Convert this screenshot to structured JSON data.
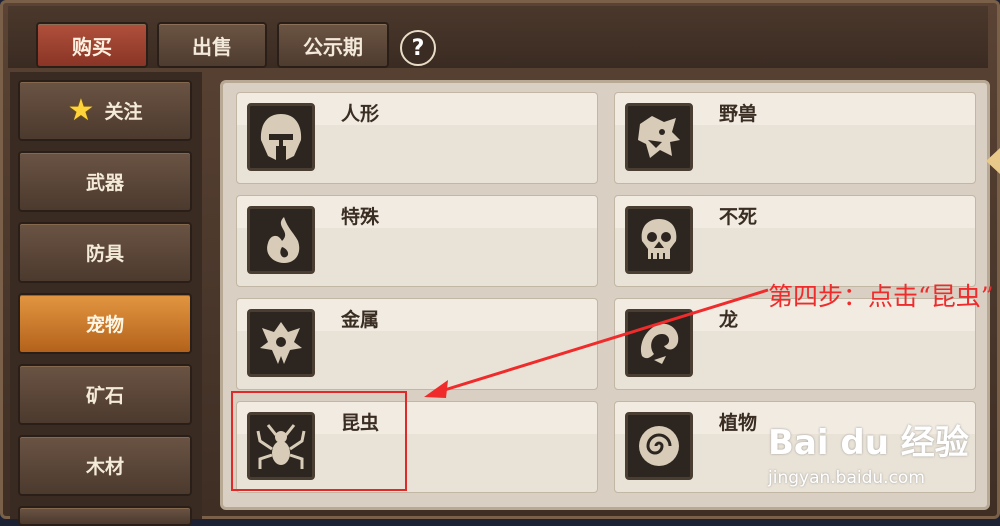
{
  "tabs": [
    {
      "label": "购买",
      "active": true
    },
    {
      "label": "出售",
      "active": false
    },
    {
      "label": "公示期",
      "active": false
    }
  ],
  "help_label": "?",
  "sidebar": {
    "items": [
      {
        "label": "关注",
        "icon": "star-icon",
        "active": false
      },
      {
        "label": "武器",
        "active": false
      },
      {
        "label": "防具",
        "active": false
      },
      {
        "label": "宠物",
        "active": true
      },
      {
        "label": "矿石",
        "active": false
      },
      {
        "label": "木材",
        "active": false
      }
    ]
  },
  "categories": [
    {
      "label": "人形",
      "icon": "helmet-icon"
    },
    {
      "label": "野兽",
      "icon": "beast-head-icon"
    },
    {
      "label": "特殊",
      "icon": "flame-icon"
    },
    {
      "label": "不死",
      "icon": "skull-icon"
    },
    {
      "label": "金属",
      "icon": "metal-emblem-icon"
    },
    {
      "label": "龙",
      "icon": "dragon-icon"
    },
    {
      "label": "昆虫",
      "icon": "spider-icon"
    },
    {
      "label": "植物",
      "icon": "plant-spiral-icon"
    }
  ],
  "annotation": {
    "text": "第四步：点击“昆虫”",
    "color": "#ef2b2b"
  },
  "watermark": {
    "brand": "Bai du 经验",
    "url": "jingyan.baidu.com"
  },
  "colors": {
    "active_tab": "#b0503c",
    "active_side": "#e29640",
    "panel": "#d9cfc2"
  }
}
